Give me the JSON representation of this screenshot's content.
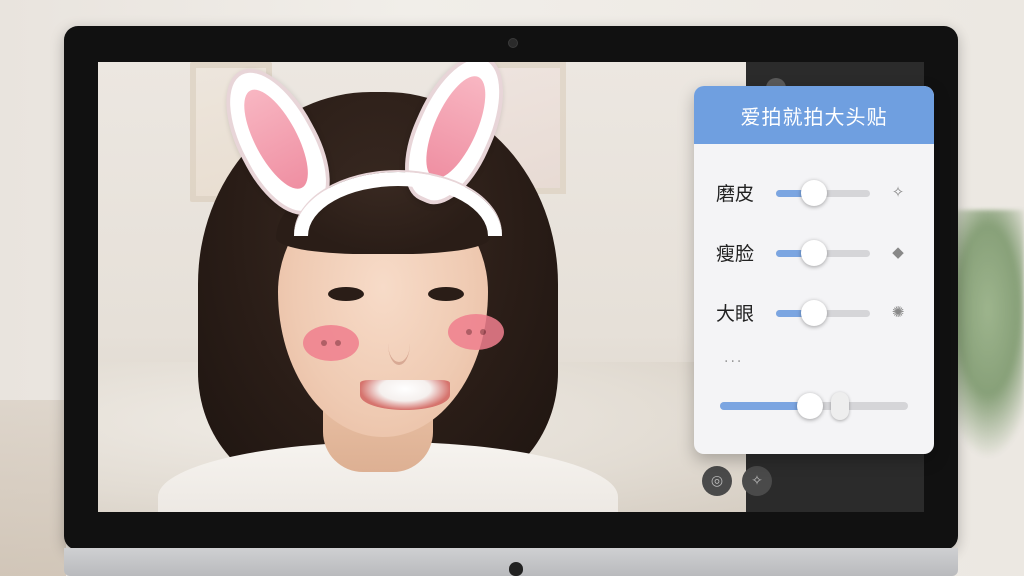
{
  "app": {
    "title": "爱拍就拍大头贴"
  },
  "controls": [
    {
      "label": "磨皮",
      "value": 0.4,
      "icon": "sparkle-icon",
      "icon_glyph": "✧"
    },
    {
      "label": "瘦脸",
      "value": 0.4,
      "icon": "face-slim-icon",
      "icon_glyph": "◆"
    },
    {
      "label": "大眼",
      "value": 0.4,
      "icon": "eye-enlarge-icon",
      "icon_glyph": "✺"
    }
  ],
  "more": "···",
  "master_slider": {
    "value": 0.48,
    "secondary_value": 0.64
  },
  "bottom_buttons": [
    {
      "icon": "camera-icon",
      "glyph": "◎"
    },
    {
      "icon": "effects-icon",
      "glyph": "✧"
    }
  ],
  "colors": {
    "accent": "#6f9fe0",
    "slider_fill": "#7ba5e1",
    "blush": "#f07f8e"
  }
}
